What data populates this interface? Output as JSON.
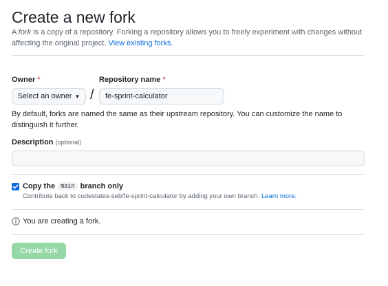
{
  "header": {
    "title": "Create a new fork",
    "intro_prefix": "A ",
    "intro_em": "fork",
    "intro_text": " is a copy of a repository. Forking a repository allows you to freely experiment with changes without affecting the original project. ",
    "intro_link": "View existing forks."
  },
  "form": {
    "owner_label": "Owner",
    "required_mark": "*",
    "owner_button": "Select an owner",
    "separator": "/",
    "repo_label": "Repository name",
    "repo_value": "fe-sprint-calculator",
    "name_help": "By default, forks are named the same as their upstream repository. You can customize the name to distinguish it further.",
    "description_label": "Description",
    "description_optional": "(optional)",
    "description_value": ""
  },
  "copy_branch": {
    "checked": true,
    "label_prefix": "Copy the ",
    "branch_name": "main",
    "label_suffix": " branch only",
    "help_text": "Contribute back to codestates-seb/fe-sprint-calculator by adding your own branch. ",
    "help_link": "Learn more."
  },
  "notice": {
    "text": "You are creating a fork."
  },
  "actions": {
    "create_label": "Create fork"
  }
}
